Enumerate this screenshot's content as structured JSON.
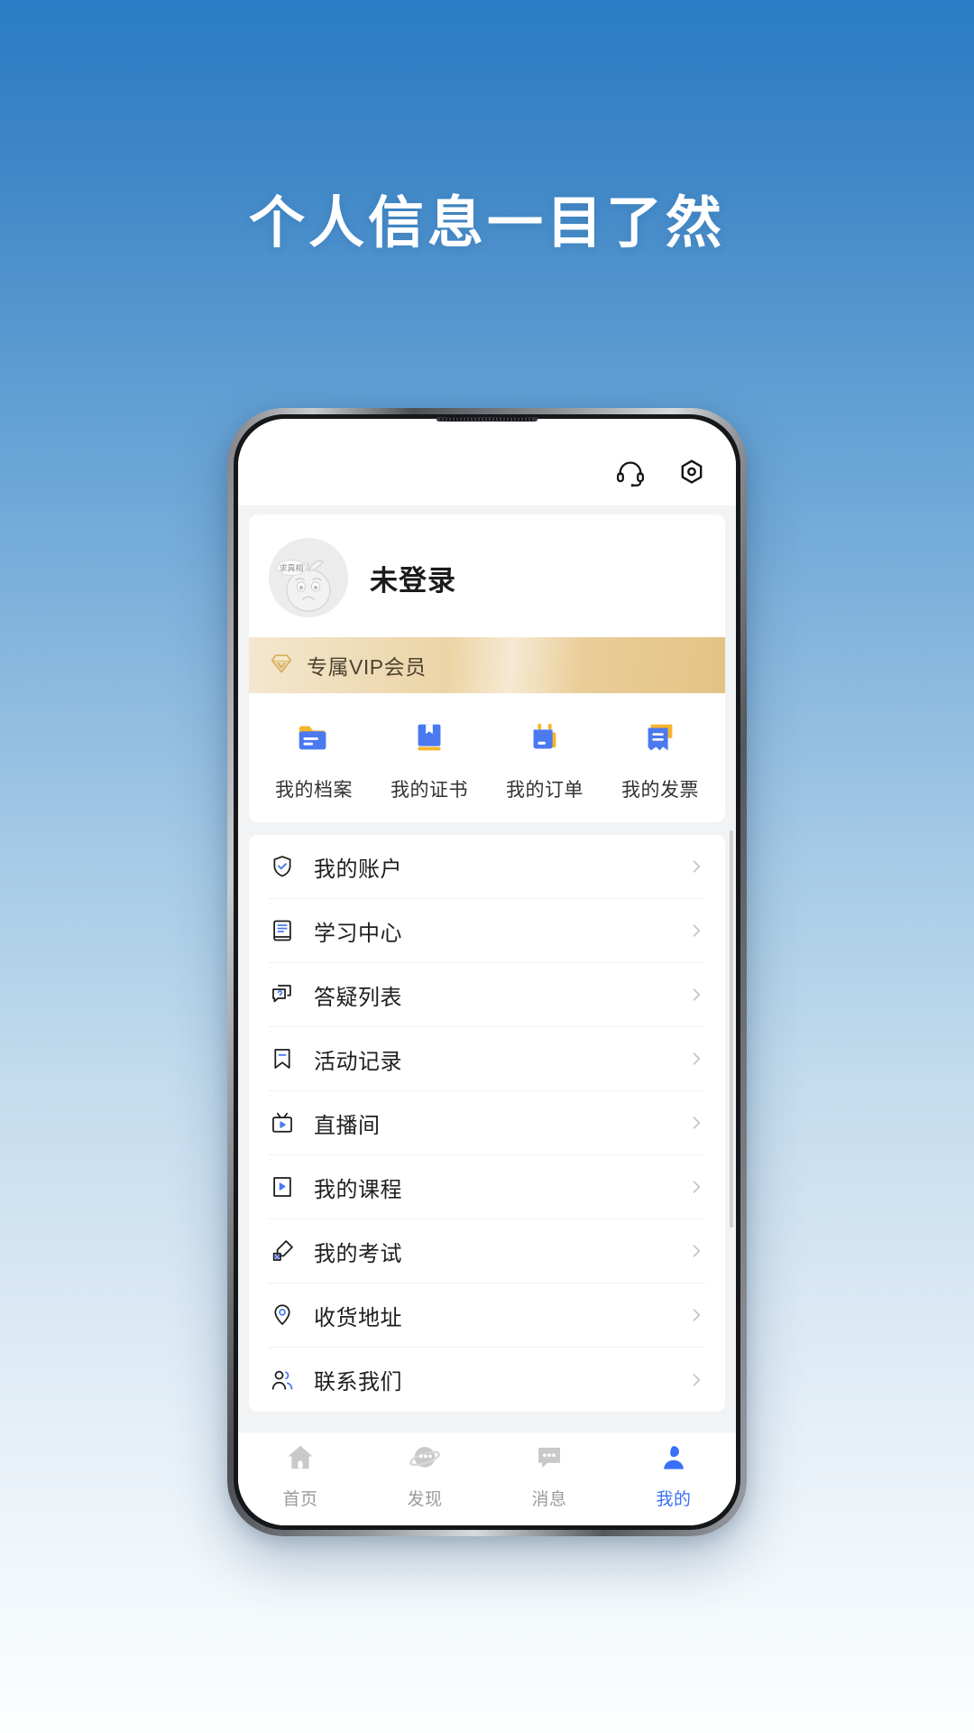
{
  "promo": {
    "headline": "个人信息一目了然"
  },
  "app": {
    "appbar": {
      "support_icon": "headset-icon",
      "settings_icon": "gear-icon"
    },
    "profile": {
      "name": "未登录",
      "avatar_bubble": "求真相",
      "avatar_icon": "user-avatar-cartoon"
    },
    "vip": {
      "label": "专属VIP会员",
      "icon": "diamond-icon",
      "gradient_from": "#f4e7cf",
      "gradient_to": "#e3c285"
    },
    "quick_actions": [
      {
        "label": "我的档案",
        "icon": "folder-icon"
      },
      {
        "label": "我的证书",
        "icon": "book-icon"
      },
      {
        "label": "我的订单",
        "icon": "clipboard-icon"
      },
      {
        "label": "我的发票",
        "icon": "receipt-icon"
      }
    ],
    "menu": [
      {
        "label": "我的账户",
        "icon": "shield-check-icon"
      },
      {
        "label": "学习中心",
        "icon": "book-lines-icon"
      },
      {
        "label": "答疑列表",
        "icon": "question-chat-icon"
      },
      {
        "label": "活动记录",
        "icon": "bookmark-icon"
      },
      {
        "label": "直播间",
        "icon": "tv-play-icon"
      },
      {
        "label": "我的课程",
        "icon": "video-play-icon"
      },
      {
        "label": "我的考试",
        "icon": "pen-edit-icon"
      },
      {
        "label": "收货地址",
        "icon": "location-pin-icon"
      },
      {
        "label": "联系我们",
        "icon": "contacts-icon"
      }
    ],
    "chevron_icon": "chevron-right-icon",
    "tabs": [
      {
        "label": "首页",
        "icon": "home-icon",
        "active": false
      },
      {
        "label": "发现",
        "icon": "planet-icon",
        "active": false
      },
      {
        "label": "消息",
        "icon": "message-icon",
        "active": false
      },
      {
        "label": "我的",
        "icon": "person-icon",
        "active": true
      }
    ],
    "colors": {
      "accent": "#3a6ff7",
      "icon_blue": "#4a79f0",
      "icon_yellow": "#f7b52c",
      "inactive": "#c9c9c9",
      "page_bg": "#f2f3f5"
    }
  }
}
